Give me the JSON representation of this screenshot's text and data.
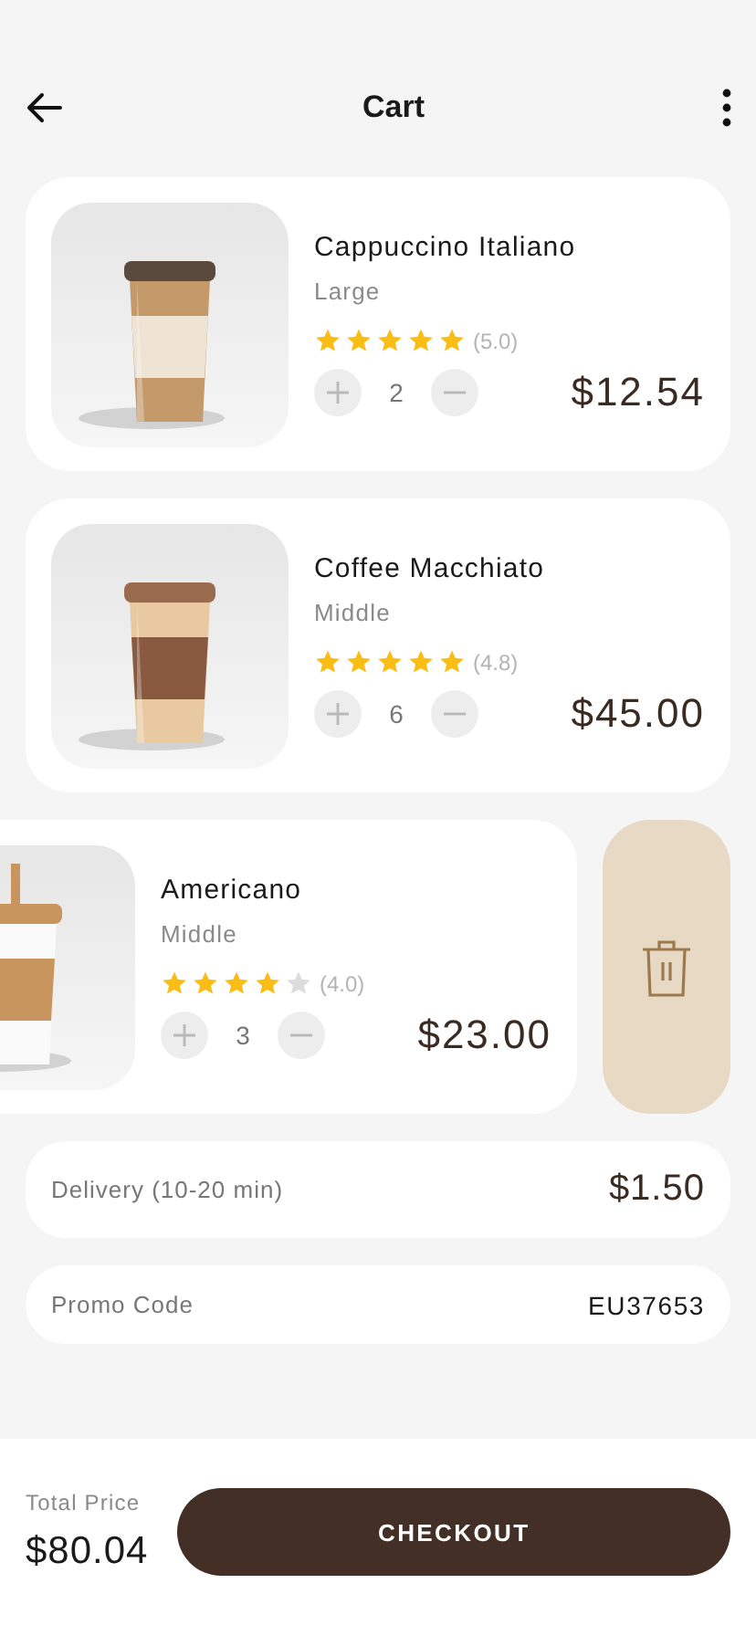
{
  "header": {
    "title": "Cart"
  },
  "items": [
    {
      "name": "Cappuccino Italiano",
      "size": "Large",
      "stars": 5,
      "rating": "(5.0)",
      "quantity": "2",
      "price": "$12.54",
      "swiped": false
    },
    {
      "name": "Coffee Macchiato",
      "size": "Middle",
      "stars": 5,
      "rating": "(4.8)",
      "quantity": "6",
      "price": "$45.00",
      "swiped": false
    },
    {
      "name": "Americano",
      "size": "Middle",
      "stars": 4,
      "rating": "(4.0)",
      "quantity": "3",
      "price": "$23.00",
      "swiped": true
    }
  ],
  "delivery": {
    "label": "Delivery (10-20 min)",
    "value": "$1.50"
  },
  "promo": {
    "label": "Promo Code",
    "value": "EU37653"
  },
  "footer": {
    "total_label": "Total Price",
    "total": "$80.04",
    "button": "CHECKOUT"
  }
}
